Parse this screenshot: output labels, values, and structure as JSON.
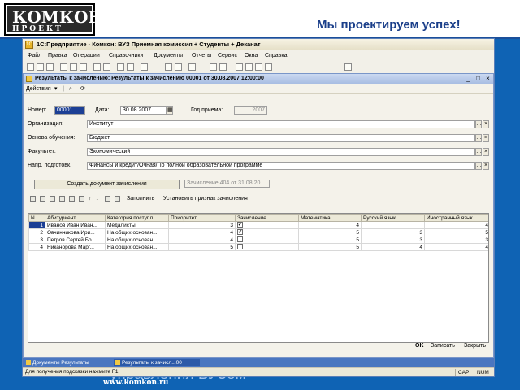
{
  "slide": {
    "logo_main": "КОМКОН",
    "logo_sub": "ПРОЕКТ",
    "slogan": "Мы проектируем успех!",
    "caption": "управления ВУЗом",
    "url": "www.komkon.ru"
  },
  "app": {
    "title": "1С:Предприятие - Комкон: ВУЗ Приемная комиссия + Студенты + Деканат",
    "menu": [
      "Файл",
      "Правка",
      "Операции",
      "Справочники",
      "Документы",
      "Отчеты",
      "Сервис",
      "Окна",
      "Справка"
    ]
  },
  "doc": {
    "title": "Результаты к зачислению: Результаты к зачислению 00001 от 30.08.2007 12:00:00",
    "actions_label": "Действия",
    "fields": {
      "number_label": "Номер:",
      "number_value": "00001",
      "date_label": "Дата:",
      "date_value": "30.08.2007",
      "year_label": "Год приема:",
      "year_value": "2007",
      "org_label": "Организация:",
      "org_value": "Институт",
      "basis_label": "Основа обучения:",
      "basis_value": "Бюджет",
      "faculty_label": "Факультет:",
      "faculty_value": "Экономический",
      "direction_label": "Напр. подготовк.",
      "direction_value": "Финансы и кредит/Очная/По полной образовательной программе"
    },
    "create_button": "Создать документ зачисления",
    "create_ref": "Зачисление 404 от 31.08.20",
    "table_actions": {
      "fill": "Заполнить",
      "set_flag": "Установить признак зачисления"
    },
    "table": {
      "headers": [
        "N",
        "Абитуриент",
        "Категория поступл...",
        "Приоритет",
        "Зачисление",
        "Математика",
        "Русский язык",
        "Иностранный язык"
      ],
      "rows": [
        {
          "n": "1",
          "name": "Иванов Иван Иван...",
          "category": "Медалисты",
          "priority": "3",
          "enrolled": "✔",
          "math": "4",
          "russian": "",
          "foreign": "4"
        },
        {
          "n": "2",
          "name": "Овчинникова Ири...",
          "category": "На общих основан...",
          "priority": "4",
          "enrolled": "✔",
          "math": "5",
          "russian": "3",
          "foreign": "5"
        },
        {
          "n": "3",
          "name": "Петров Сергей Бо...",
          "category": "На общих основан...",
          "priority": "4",
          "enrolled": "",
          "math": "5",
          "russian": "3",
          "foreign": "3"
        },
        {
          "n": "4",
          "name": "Никанорова Марг...",
          "category": "На общих основан...",
          "priority": "5",
          "enrolled": "",
          "math": "5",
          "russian": "4",
          "foreign": "4"
        }
      ]
    },
    "footer": {
      "ok": "OK",
      "save": "Записать",
      "close": "Закрыть"
    }
  },
  "taskbar": {
    "items": [
      "Документы Результаты",
      "Результаты к зачисл...00"
    ]
  },
  "status": {
    "hint": "Для получения подсказки нажмите F1",
    "cap": "CAP",
    "num": "NUM"
  }
}
